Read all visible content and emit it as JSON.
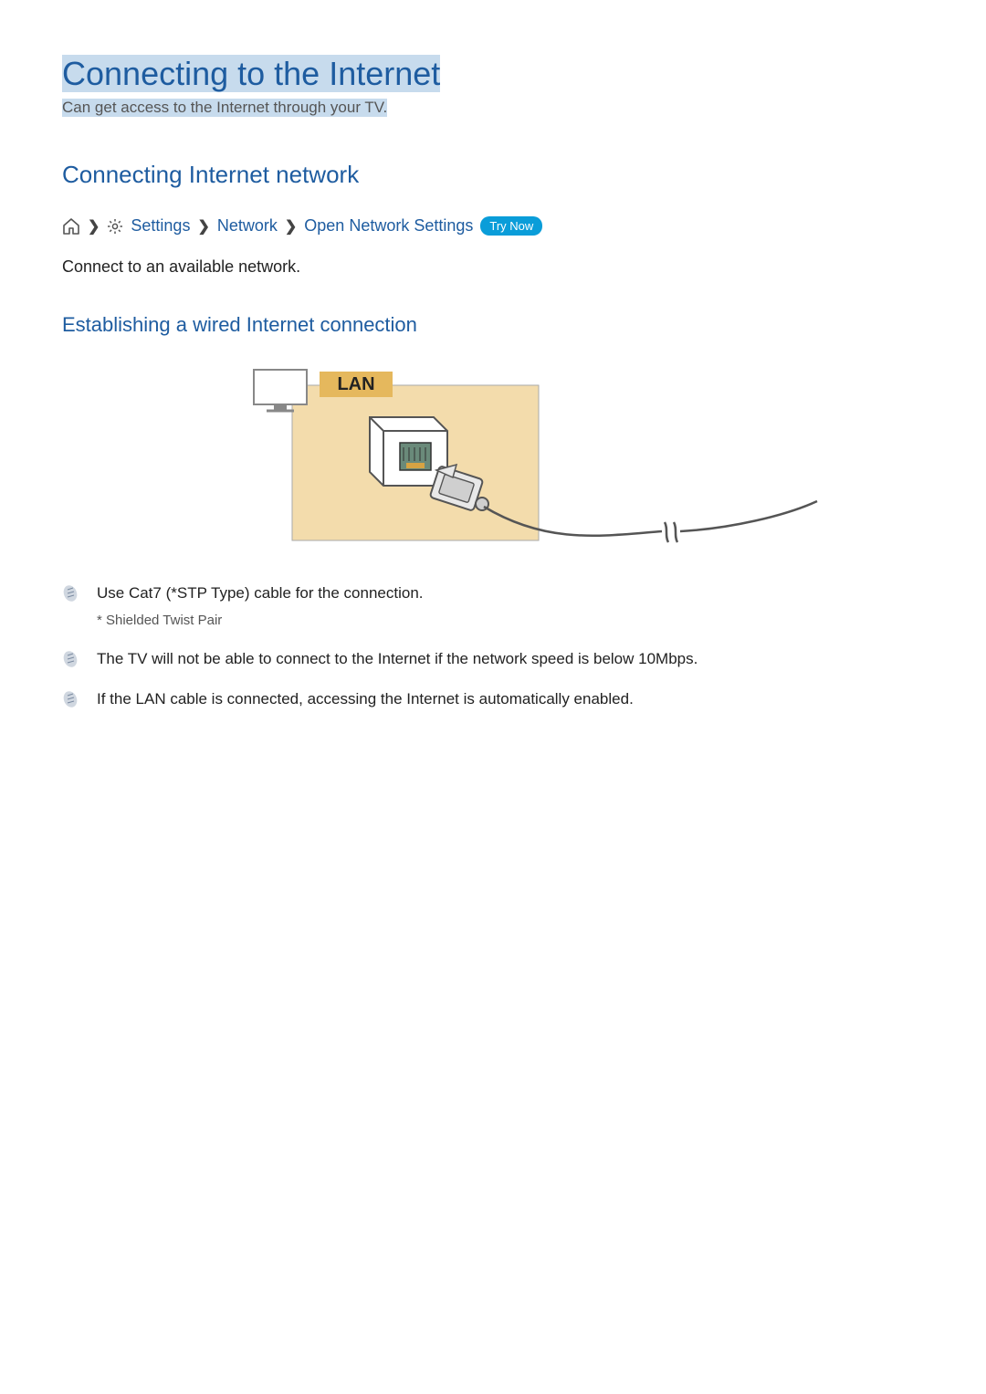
{
  "page": {
    "title": "Connecting to the Internet",
    "subtitle": "Can get access to the Internet through your TV."
  },
  "section": {
    "title": "Connecting Internet network"
  },
  "breadcrumb": {
    "settings": "Settings",
    "network": "Network",
    "open_network_settings": "Open Network Settings",
    "try_now": "Try Now"
  },
  "body": {
    "connect_network": "Connect to an available network."
  },
  "subsection": {
    "title": "Establishing a wired Internet connection"
  },
  "diagram": {
    "lan_label": "LAN"
  },
  "notes": [
    {
      "text": "Use Cat7 (*STP Type) cable for the connection.",
      "sub": "* Shielded Twist Pair"
    },
    {
      "text": "The TV will not be able to connect to the Internet if the network speed is below 10Mbps."
    },
    {
      "text": "If the LAN cable is connected, accessing the Internet is automatically enabled."
    }
  ]
}
